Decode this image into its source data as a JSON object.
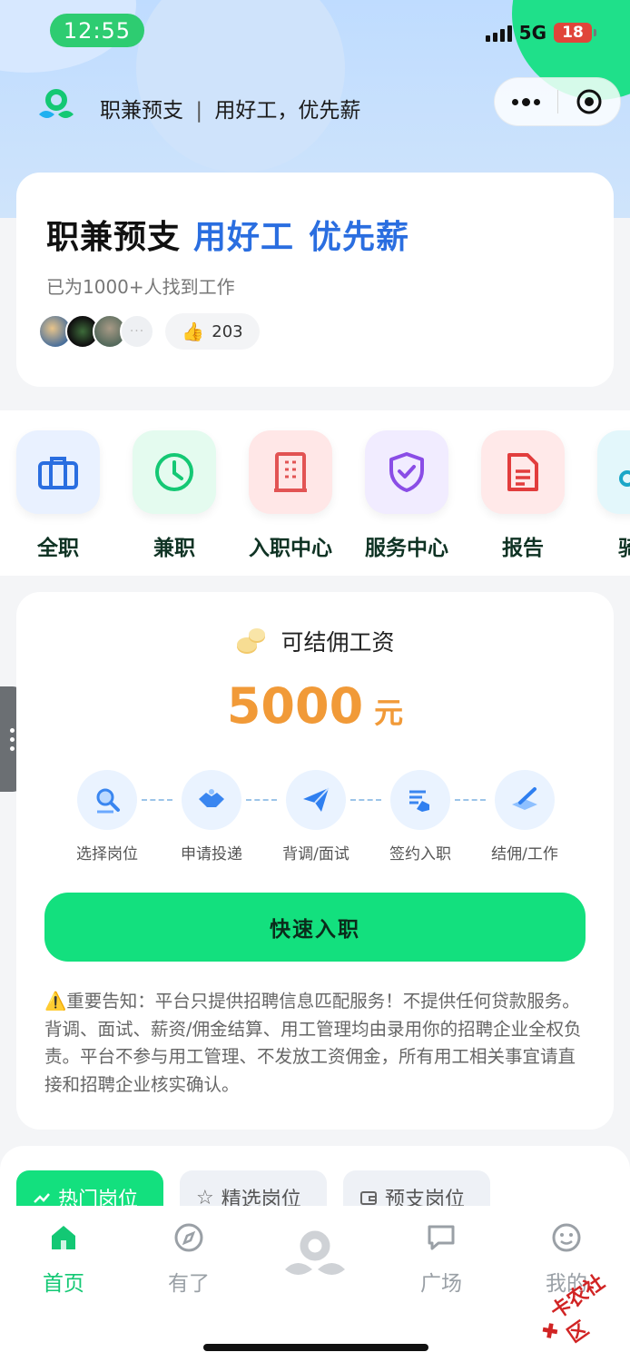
{
  "status_bar": {
    "time": "12:55",
    "network": "5G",
    "battery": "18"
  },
  "nav": {
    "app_name": "职兼预支",
    "divider": "|",
    "slogan": "用好工，优先薪"
  },
  "hero": {
    "title_main": "职兼预支",
    "title_accent1": "用好工",
    "title_accent2": "优先薪",
    "subtitle": "已为1000+人找到工作",
    "likes": "203",
    "more_avatars": "···"
  },
  "categories": [
    {
      "label": "全职",
      "icon": "briefcase-icon"
    },
    {
      "label": "兼职",
      "icon": "clock-icon"
    },
    {
      "label": "入职中心",
      "icon": "building-icon"
    },
    {
      "label": "服务中心",
      "icon": "shield-check-icon"
    },
    {
      "label": "报告",
      "icon": "document-icon"
    },
    {
      "label": "骑手",
      "icon": "rider-icon"
    }
  ],
  "salary": {
    "title": "可结佣工资",
    "amount": "5000",
    "unit": "元"
  },
  "steps": [
    {
      "label": "选择岗位",
      "icon": "search-person-icon"
    },
    {
      "label": "申请投递",
      "icon": "handshake-icon"
    },
    {
      "label": "背调/面试",
      "icon": "paper-plane-icon"
    },
    {
      "label": "签约入职",
      "icon": "sign-icon"
    },
    {
      "label": "结佣/工作",
      "icon": "pen-board-icon"
    }
  ],
  "cta": {
    "label": "快速入职"
  },
  "notice": {
    "text": "⚠️重要告知：平台只提供招聘信息匹配服务！不提供任何贷款服务。背调、面试、薪资/佣金结算、用工管理均由录用你的招聘企业全权负责。平台不参与用工管理、不发放工资佣金，所有用工相关事宜请直接和招聘企业核实确认。"
  },
  "tabs": [
    {
      "label": "热门岗位",
      "icon": "trending-icon"
    },
    {
      "label": "精选岗位",
      "icon": "star-icon"
    },
    {
      "label": "预支岗位",
      "icon": "wallet-icon"
    }
  ],
  "bottom_nav": [
    {
      "label": "首页",
      "icon": "home-icon",
      "active": true
    },
    {
      "label": "有了",
      "icon": "compass-icon"
    },
    {
      "label": "",
      "icon": "center-logo-icon"
    },
    {
      "label": "广场",
      "icon": "chat-icon"
    },
    {
      "label": "我的",
      "icon": "smile-icon"
    }
  ],
  "watermark": {
    "text": "卡农社区"
  },
  "colors": {
    "brand_green": "#13e07e",
    "accent_blue": "#2a6ee0",
    "amount_orange": "#f19a38"
  }
}
